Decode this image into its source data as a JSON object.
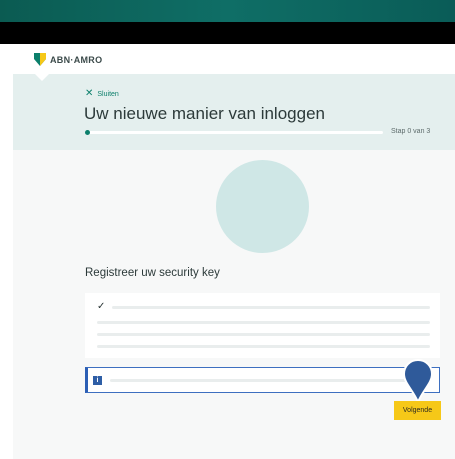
{
  "header": {
    "brand": "ABN·AMRO",
    "close_label": "Sluiten",
    "title": "Uw nieuwe manier van inloggen",
    "step_text": "Stap 0 van 3",
    "progress": 0
  },
  "main": {
    "subtitle": "Registreer uw security key",
    "next_label": "Volgende"
  },
  "icons": {
    "logo": "abn-amro-shield-icon",
    "close": "close-icon",
    "check": "check-icon",
    "info": "info-icon",
    "pin": "pointer-pin-icon"
  },
  "colors": {
    "accent": "#0b7f6b",
    "button": "#f6c818",
    "info": "#2c5fb5"
  }
}
